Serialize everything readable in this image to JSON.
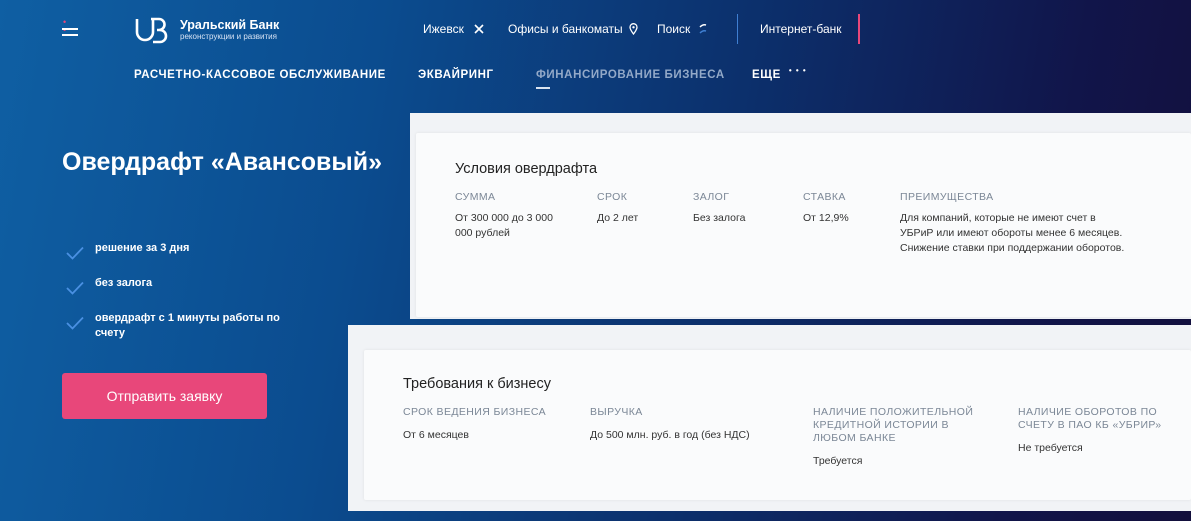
{
  "header": {
    "logo_title": "Уральский Банк",
    "logo_subtitle": "реконструкции и развития",
    "city": "Ижевск",
    "offices": "Офисы и банкоматы",
    "search": "Поиск",
    "internet_bank": "Интернет-банк"
  },
  "nav": {
    "items": [
      {
        "label": "РАСЧЕТНО-КАССОВОЕ ОБСЛУЖИВАНИЕ"
      },
      {
        "label": "ЭКВАЙРИНГ"
      },
      {
        "label": "ФИНАНСИРОВАНИЕ БИЗНЕСА",
        "active": true
      },
      {
        "label": "ЕЩЕ"
      }
    ],
    "more_dots": "• • •"
  },
  "hero": {
    "title": "Овердрафт «Авансовый»",
    "features": [
      "решение за 3 дня",
      "без залога",
      "овердрафт с 1 минуты работы по счету"
    ],
    "cta": "Отправить заявку"
  },
  "conditions": {
    "title": "Условия овердрафта",
    "columns": [
      {
        "head": "СУММА",
        "value": "От 300 000 до 3 000 000 рублей"
      },
      {
        "head": "СРОК",
        "value": "До 2 лет"
      },
      {
        "head": "ЗАЛОГ",
        "value": "Без залога"
      },
      {
        "head": "СТАВКА",
        "value": "От 12,9%"
      },
      {
        "head": "ПРЕИМУЩЕСТВА",
        "value": "Для компаний, которые не имеют счет в УБРиР или имеют обороты менее 6 месяцев. Снижение ставки при поддержании оборотов."
      }
    ]
  },
  "requirements": {
    "title": "Требования к бизнесу",
    "columns": [
      {
        "head": "СРОК ВЕДЕНИЯ БИЗНЕСА",
        "value": "От 6 месяцев"
      },
      {
        "head": "ВЫРУЧКА",
        "value": "До 500 млн. руб. в год (без НДС)"
      },
      {
        "head": "НАЛИЧИЕ ПОЛОЖИТЕЛЬНОЙ КРЕДИТНОЙ ИСТОРИИ В ЛЮБОМ БАНКЕ",
        "value": "Требуется"
      },
      {
        "head": "НАЛИЧИЕ ОБОРОТОВ ПО СЧЕТУ В ПАО КБ «УБРИР»",
        "value": "Не требуется"
      }
    ]
  },
  "colors": {
    "accent": "#e8477a",
    "check": "#4a90e2",
    "bg_left": "#0f5fa3",
    "bg_right": "#130f3c"
  }
}
